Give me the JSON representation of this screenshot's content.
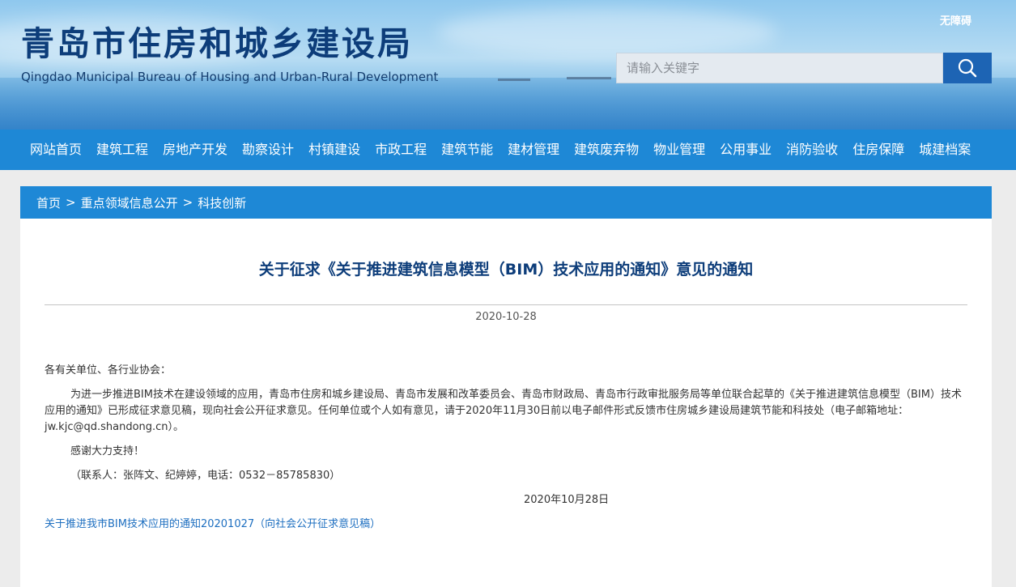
{
  "header": {
    "title_cn": "青岛市住房和城乡建设局",
    "title_en": "Qingdao Municipal Bureau of Housing and Urban-Rural Development",
    "accessibility_label": "无障碍",
    "search_placeholder": "请输入关键字",
    "search_icon": "search-icon"
  },
  "nav": {
    "items": [
      "网站首页",
      "建筑工程",
      "房地产开发",
      "勘察设计",
      "村镇建设",
      "市政工程",
      "建筑节能",
      "建材管理",
      "建筑废弃物",
      "物业管理",
      "公用事业",
      "消防验收",
      "住房保障",
      "城建档案"
    ]
  },
  "breadcrumb": {
    "items": [
      "首页",
      "重点领域信息公开",
      "科技创新"
    ],
    "separator": ">"
  },
  "article": {
    "title": "关于征求《关于推进建筑信息模型（BIM）技术应用的通知》意见的通知",
    "date": "2020-10-28",
    "salutation": "各有关单位、各行业协会：",
    "body": "为进一步推进BIM技术在建设领域的应用，青岛市住房和城乡建设局、青岛市发展和改革委员会、青岛市财政局、青岛市行政审批服务局等单位联合起草的《关于推进建筑信息模型（BIM）技术应用的通知》已形成征求意见稿，现向社会公开征求意见。任何单位或个人如有意见，请于2020年11月30日前以电子邮件形式反馈市住房城乡建设局建筑节能和科技处（电子邮箱地址：jw.kjc@qd.shandong.cn）。",
    "thanks": "感谢大力支持！",
    "contact": "（联系人：张阵文、纪婷婷，电话：0532－85785830）",
    "sign_date": "2020年10月28日",
    "attachment": "关于推进我市BIM技术应用的通知20201027（向社会公开征求意见稿）"
  },
  "colors": {
    "nav_bg": "#1e88d6",
    "title_color": "#0d3d7a",
    "search_button": "#1d64b4",
    "link_color": "#1e6fc0"
  }
}
